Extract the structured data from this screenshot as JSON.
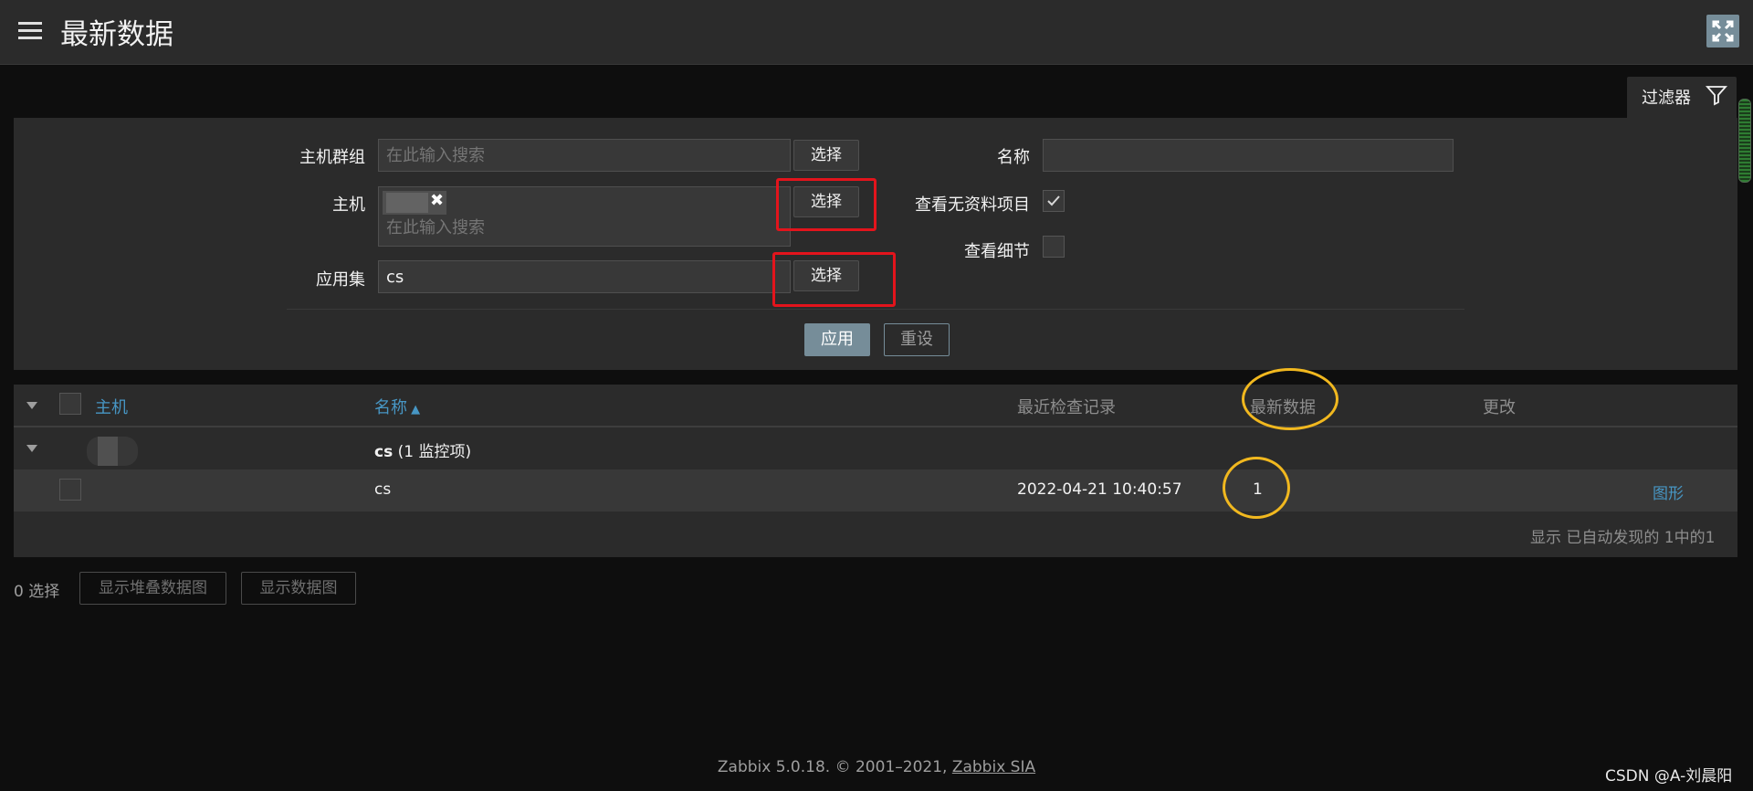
{
  "header": {
    "title": "最新数据"
  },
  "filter": {
    "tab_label": "过滤器",
    "host_group_label": "主机群组",
    "host_group_placeholder": "在此输入搜索",
    "host_label": "主机",
    "host_placeholder": "在此输入搜索",
    "application_label": "应用集",
    "application_value": "cs",
    "select_label": "选择",
    "name_label": "名称",
    "name_value": "",
    "show_without_data_label": "查看无资料项目",
    "show_without_data_checked": true,
    "show_details_label": "查看细节",
    "show_details_checked": false,
    "apply_label": "应用",
    "reset_label": "重设"
  },
  "table": {
    "columns": {
      "host": "主机",
      "name": "名称",
      "last_check": "最近检查记录",
      "last_value": "最新数据",
      "change": "更改"
    },
    "group_row": {
      "name": "cs",
      "count": "(1 监控项)"
    },
    "item_row": {
      "name": "cs",
      "last_check": "2022-04-21 10:40:57",
      "last_value": "1",
      "graph_link": "图形"
    },
    "footer_text": "显示 已自动发现的 1中的1"
  },
  "actions": {
    "selected_count": "0 选择",
    "stacked_graph_label": "显示堆叠数据图",
    "graph_label": "显示数据图"
  },
  "footer": {
    "version_text": "Zabbix 5.0.18. © 2001–2021, ",
    "company_link": "Zabbix SIA"
  },
  "watermark": "CSDN @A-刘晨阳",
  "colors": {
    "link": "#4796c4",
    "primary_button": "#768d99",
    "red_annotation": "#e3141c",
    "gold_annotation": "#f1b81f"
  }
}
